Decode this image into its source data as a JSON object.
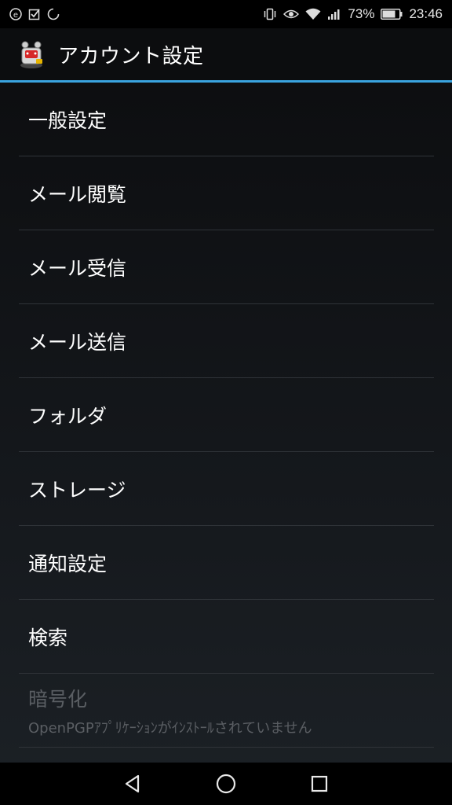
{
  "status_bar": {
    "left_icons": [
      "e-notification-icon",
      "checkbox-notification-icon",
      "circle-notification-icon"
    ],
    "right_icons": [
      "vibrate-icon",
      "eye-icon",
      "wifi-icon",
      "signal-icon",
      "battery-icon"
    ],
    "battery_percent": "73%",
    "time": "23:46"
  },
  "app_bar": {
    "title": "アカウント設定",
    "logo_icon": "app-mascot-icon"
  },
  "settings": {
    "items": [
      {
        "label": "一般設定"
      },
      {
        "label": "メール閲覧"
      },
      {
        "label": "メール受信"
      },
      {
        "label": "メール送信"
      },
      {
        "label": "フォルダ"
      },
      {
        "label": "ストレージ"
      },
      {
        "label": "通知設定"
      },
      {
        "label": "検索"
      }
    ],
    "encryption": {
      "label": "暗号化",
      "summary": "OpenPGPｱﾌﾟﾘｹｰｼｮﾝがｲﾝｽﾄｰﾙされていません"
    }
  },
  "nav_bar": {
    "back_icon": "back-triangle-icon",
    "home_icon": "home-circle-icon",
    "recents_icon": "recents-square-icon"
  },
  "colors": {
    "accent": "#3aa3df",
    "background": "#0b0c0e",
    "divider": "#2f3338",
    "disabled_text": "#5a5e63"
  }
}
